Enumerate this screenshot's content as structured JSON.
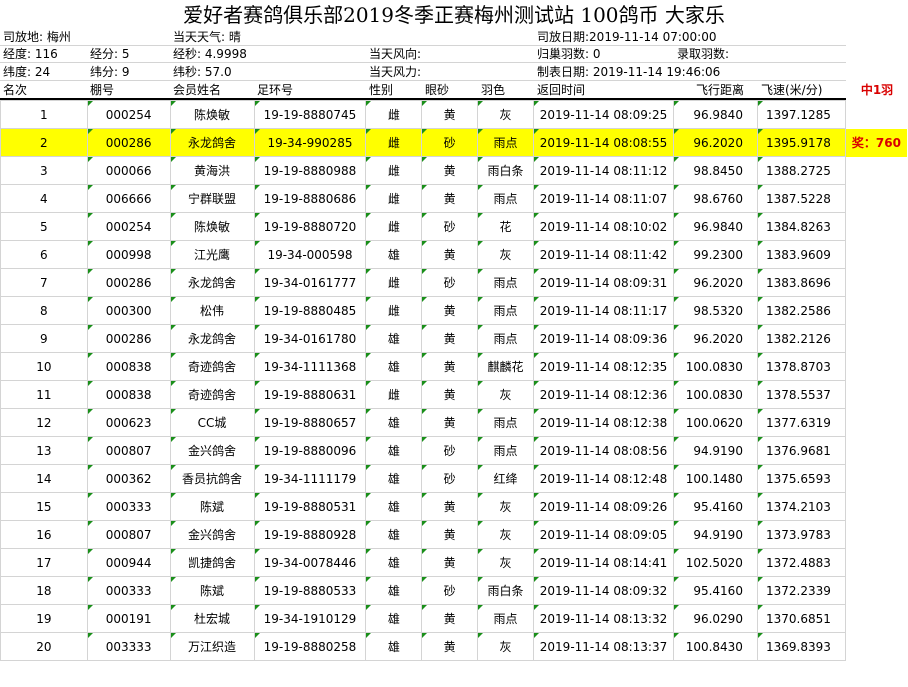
{
  "title": "爱好者赛鸽俱乐部2019冬季正赛梅州测试站 100鸽币 大家乐",
  "info": {
    "release_place": "司放地: 梅州",
    "weather": "当天天气: 晴",
    "release_date": "司放日期:2019-11-14 07:00:00",
    "longitude": "经度: 116",
    "lon_min": "经分: 5",
    "lon_sec": "经秒: 4.9998",
    "wind_dir": "当天风向:",
    "returned": "归巢羽数: 0",
    "recorded": "录取羽数:",
    "latitude": "纬度:  24",
    "lat_min": "纬分: 9",
    "lat_sec": "纬秒: 57.0",
    "wind_force": "当天风力:",
    "report_date": "制表日期: 2019-11-14 19:46:06"
  },
  "headers": [
    "名次",
    "棚号",
    "会员姓名",
    "足环号",
    "性别",
    "眼砂",
    "羽色",
    "返回时间",
    "飞行距离",
    "飞速(米/分)"
  ],
  "extra_header": "中1羽",
  "prize": "奖：760",
  "rows": [
    {
      "rank": "1",
      "shed": "000254",
      "name": "陈焕敏",
      "ring": "19-19-8880745",
      "sex": "雌",
      "eye": "黄",
      "color": "灰",
      "time": "2019-11-14 08:09:25",
      "dist": "96.9840",
      "speed": "1397.1285"
    },
    {
      "rank": "2",
      "shed": "000286",
      "name": "永龙鸽舍",
      "ring": "19-34-990285",
      "sex": "雌",
      "eye": "砂",
      "color": "雨点",
      "time": "2019-11-14 08:08:55",
      "dist": "96.2020",
      "speed": "1395.9178"
    },
    {
      "rank": "3",
      "shed": "000066",
      "name": "黄海洪",
      "ring": "19-19-8880988",
      "sex": "雌",
      "eye": "黄",
      "color": "雨白条",
      "time": "2019-11-14 08:11:12",
      "dist": "98.8450",
      "speed": "1388.2725"
    },
    {
      "rank": "4",
      "shed": "006666",
      "name": "宁群联盟",
      "ring": "19-19-8880686",
      "sex": "雌",
      "eye": "黄",
      "color": "雨点",
      "time": "2019-11-14 08:11:07",
      "dist": "98.6760",
      "speed": "1387.5228"
    },
    {
      "rank": "5",
      "shed": "000254",
      "name": "陈焕敏",
      "ring": "19-19-8880720",
      "sex": "雌",
      "eye": "砂",
      "color": "花",
      "time": "2019-11-14 08:10:02",
      "dist": "96.9840",
      "speed": "1384.8263"
    },
    {
      "rank": "6",
      "shed": "000998",
      "name": "江光鹰",
      "ring": "19-34-000598",
      "sex": "雄",
      "eye": "黄",
      "color": "灰",
      "time": "2019-11-14 08:11:42",
      "dist": "99.2300",
      "speed": "1383.9609"
    },
    {
      "rank": "7",
      "shed": "000286",
      "name": "永龙鸽舍",
      "ring": "19-34-0161777",
      "sex": "雌",
      "eye": "砂",
      "color": "雨点",
      "time": "2019-11-14 08:09:31",
      "dist": "96.2020",
      "speed": "1383.8696"
    },
    {
      "rank": "8",
      "shed": "000300",
      "name": "松伟",
      "ring": "19-19-8880485",
      "sex": "雌",
      "eye": "黄",
      "color": "雨点",
      "time": "2019-11-14 08:11:17",
      "dist": "98.5320",
      "speed": "1382.2586"
    },
    {
      "rank": "9",
      "shed": "000286",
      "name": "永龙鸽舍",
      "ring": "19-34-0161780",
      "sex": "雄",
      "eye": "黄",
      "color": "雨点",
      "time": "2019-11-14 08:09:36",
      "dist": "96.2020",
      "speed": "1382.2126"
    },
    {
      "rank": "10",
      "shed": "000838",
      "name": "奇迹鸽舍",
      "ring": "19-34-1111368",
      "sex": "雄",
      "eye": "黄",
      "color": "麒麟花",
      "time": "2019-11-14 08:12:35",
      "dist": "100.0830",
      "speed": "1378.8703"
    },
    {
      "rank": "11",
      "shed": "000838",
      "name": "奇迹鸽舍",
      "ring": "19-19-8880631",
      "sex": "雌",
      "eye": "黄",
      "color": "灰",
      "time": "2019-11-14 08:12:36",
      "dist": "100.0830",
      "speed": "1378.5537"
    },
    {
      "rank": "12",
      "shed": "000623",
      "name": "CC城",
      "ring": "19-19-8880657",
      "sex": "雄",
      "eye": "黄",
      "color": "雨点",
      "time": "2019-11-14 08:12:38",
      "dist": "100.0620",
      "speed": "1377.6319"
    },
    {
      "rank": "13",
      "shed": "000807",
      "name": "金兴鸽舍",
      "ring": "19-19-8880096",
      "sex": "雄",
      "eye": "砂",
      "color": "雨点",
      "time": "2019-11-14 08:08:56",
      "dist": "94.9190",
      "speed": "1376.9681"
    },
    {
      "rank": "14",
      "shed": "000362",
      "name": "香员抗鸽舍",
      "ring": "19-34-1111179",
      "sex": "雄",
      "eye": "砂",
      "color": "红绛",
      "time": "2019-11-14 08:12:48",
      "dist": "100.1480",
      "speed": "1375.6593"
    },
    {
      "rank": "15",
      "shed": "000333",
      "name": "陈斌",
      "ring": "19-19-8880531",
      "sex": "雄",
      "eye": "黄",
      "color": "灰",
      "time": "2019-11-14 08:09:26",
      "dist": "95.4160",
      "speed": "1374.2103"
    },
    {
      "rank": "16",
      "shed": "000807",
      "name": "金兴鸽舍",
      "ring": "19-19-8880928",
      "sex": "雄",
      "eye": "黄",
      "color": "灰",
      "time": "2019-11-14 08:09:05",
      "dist": "94.9190",
      "speed": "1373.9783"
    },
    {
      "rank": "17",
      "shed": "000944",
      "name": "凯捷鸽舍",
      "ring": "19-34-0078446",
      "sex": "雄",
      "eye": "黄",
      "color": "灰",
      "time": "2019-11-14 08:14:41",
      "dist": "102.5020",
      "speed": "1372.4883"
    },
    {
      "rank": "18",
      "shed": "000333",
      "name": "陈斌",
      "ring": "19-19-8880533",
      "sex": "雄",
      "eye": "砂",
      "color": "雨白条",
      "time": "2019-11-14 08:09:32",
      "dist": "95.4160",
      "speed": "1372.2339"
    },
    {
      "rank": "19",
      "shed": "000191",
      "name": "杜宏城",
      "ring": "19-34-1910129",
      "sex": "雄",
      "eye": "黄",
      "color": "雨点",
      "time": "2019-11-14 08:13:32",
      "dist": "96.0290",
      "speed": "1370.6851"
    },
    {
      "rank": "20",
      "shed": "003333",
      "name": "万江织造",
      "ring": "19-19-8880258",
      "sex": "雄",
      "eye": "黄",
      "color": "灰",
      "time": "2019-11-14 08:13:37",
      "dist": "100.8430",
      "speed": "1369.8393"
    }
  ]
}
